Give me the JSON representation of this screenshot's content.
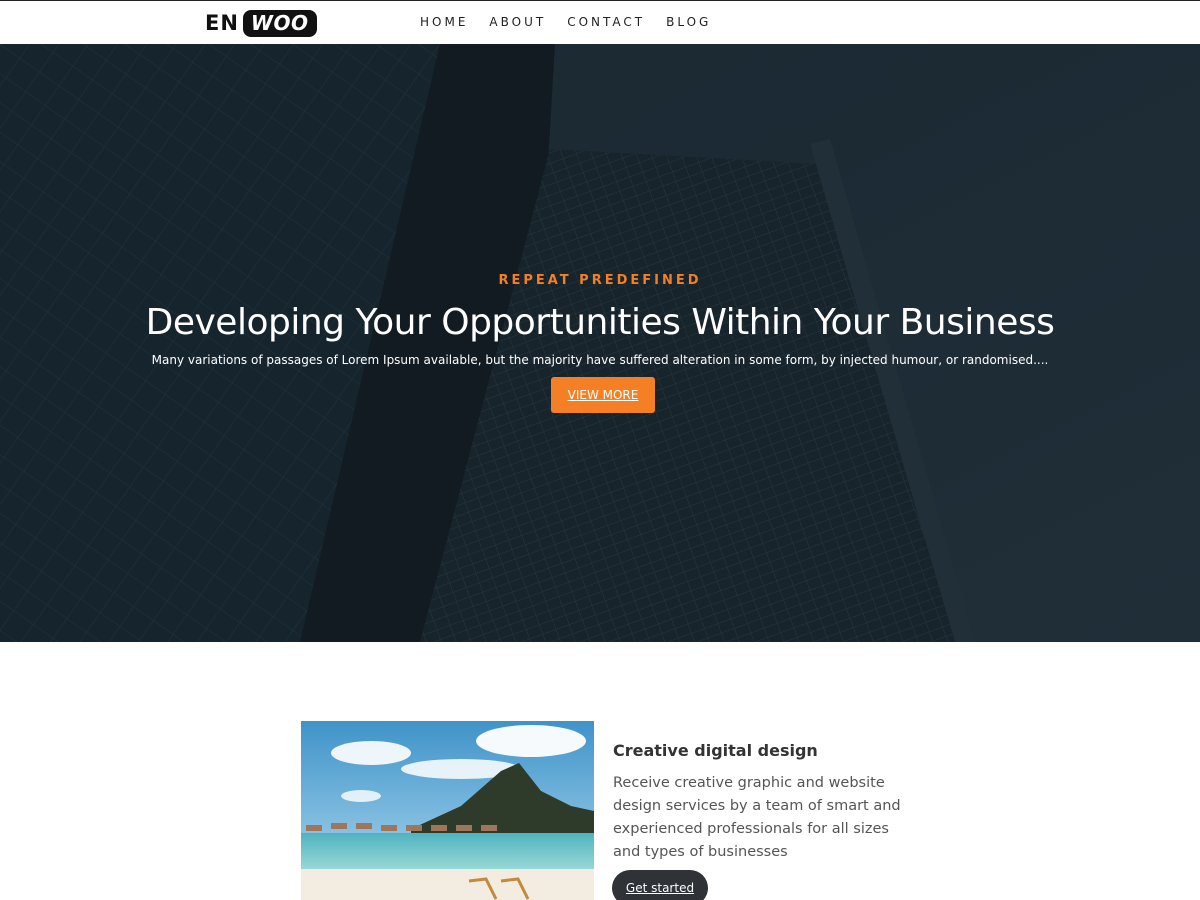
{
  "brand": {
    "part1": "EN",
    "part2": "WOO"
  },
  "nav": [
    {
      "label": "HOME"
    },
    {
      "label": "ABOUT"
    },
    {
      "label": "CONTACT"
    },
    {
      "label": "BLOG"
    }
  ],
  "hero": {
    "eyebrow": "REPEAT PREDEFINED",
    "title": "Developing Your Opportunities Within Your Business",
    "subtitle": "Many variations of passages of Lorem Ipsum available, but the majority have suffered alteration in some form, by injected humour, or randomised....",
    "button_label": "VIEW MORE"
  },
  "feature": {
    "title": "Creative digital design",
    "text": "Receive creative graphic and website design services by a team of smart and experienced professionals for all sizes and types of businesses",
    "button_label": "Get started"
  },
  "colors": {
    "accent": "#f47f25",
    "hero_overlay": "#1b2a33",
    "dark_button": "#2f3237"
  }
}
